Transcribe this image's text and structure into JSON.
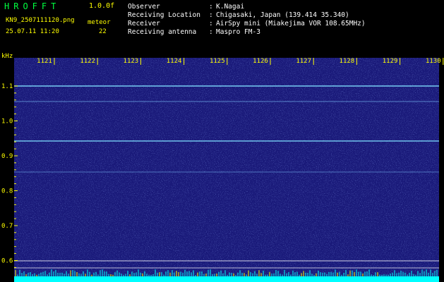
{
  "header": {
    "app_title": "HROFFT",
    "version": "1.0.0f",
    "filename": "KN9_2507111120.png",
    "mode": "meteor",
    "datetime": "25.07.11 11:20",
    "count": "22"
  },
  "info": [
    {
      "label": "Observer",
      "value": "K.Nagai"
    },
    {
      "label": "Receiving Location",
      "value": "Chigasaki, Japan (139.414 35.340)"
    },
    {
      "label": "Receiver",
      "value": "AirSpy mini (Miakejima VOR 108.65MHz)"
    },
    {
      "label": "Receiving antenna",
      "value": "Maspro FM-3"
    }
  ],
  "spectrogram": {
    "y_unit": "kHz",
    "y_ticks": [
      "1.1",
      "1.0",
      "0.9",
      "0.8",
      "0.7",
      "0.6"
    ],
    "x_ticks": [
      "1121",
      "1122",
      "1123",
      "1124",
      "1125",
      "1126",
      "1127",
      "1128",
      "1129",
      "1130"
    ],
    "background_color": "#1a1a7a",
    "noise_color": "#5070ff",
    "tick_color": "#ffff00",
    "trace_color": "#80e0ff",
    "power_color": "#00ffff"
  }
}
